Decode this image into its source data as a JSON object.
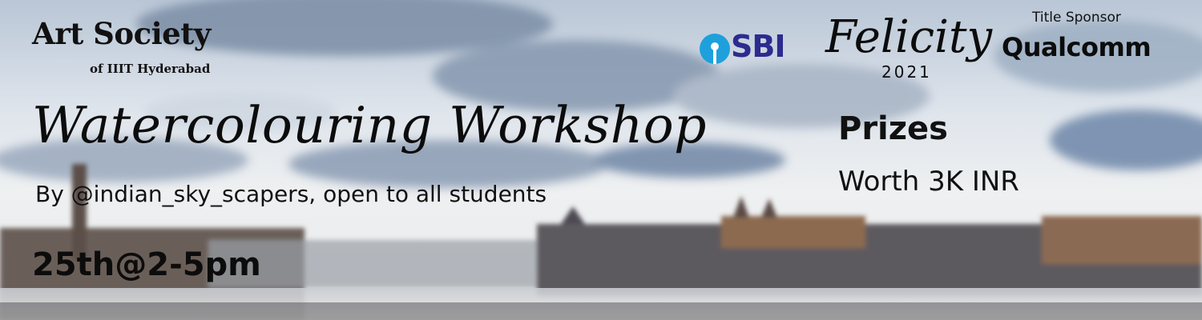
{
  "organizer": {
    "name": "Art Society",
    "subtitle": "of IIIT Hyderabad"
  },
  "event": {
    "title": "Watercolouring Workshop",
    "byline": "By @indian_sky_scapers, open to all students",
    "datetime": "25th@2-5pm"
  },
  "prizes": {
    "title": "Prizes",
    "detail": "Worth 3K INR"
  },
  "logos": {
    "sbi": "SBI",
    "felicity_word": "Felicity",
    "felicity_year": "2021",
    "sponsor_label": "Title Sponsor",
    "sponsor_name": "Qualcomm"
  },
  "colors": {
    "sbi_blue": "#2c2b8f",
    "sbi_icon": "#1ea0dd",
    "text": "#111111"
  }
}
